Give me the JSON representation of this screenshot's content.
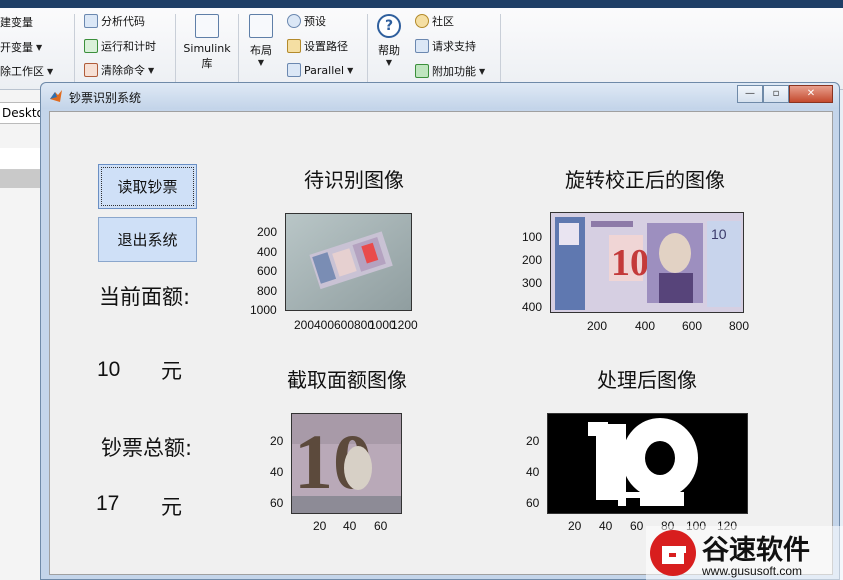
{
  "toolstrip": {
    "items": [
      {
        "label": "建变量",
        "name": "new-variable"
      },
      {
        "label": "开变量",
        "name": "open-variable"
      },
      {
        "label": "除工作区",
        "name": "clear-workspace"
      },
      {
        "label": "分析代码",
        "name": "analyze-code"
      },
      {
        "label": "运行和计时",
        "name": "run-and-time"
      },
      {
        "label": "清除命令",
        "name": "clear-commands"
      },
      {
        "label": "预设",
        "name": "preferences"
      },
      {
        "label": "设置路径",
        "name": "set-path"
      },
      {
        "label": "Parallel",
        "name": "parallel"
      },
      {
        "label": "社区",
        "name": "community"
      },
      {
        "label": "请求支持",
        "name": "request-support"
      },
      {
        "label": "附加功能",
        "name": "add-ons"
      }
    ],
    "simulink_line1": "Simulink",
    "simulink_line2": "库",
    "layout": "布局",
    "help": "帮助"
  },
  "left_pane": {
    "address": "Deskto"
  },
  "figure": {
    "title": "钞票识别系统",
    "buttons": {
      "read": "读取钞票",
      "exit": "退出系统"
    },
    "current_label": "当前面额:",
    "current_value": "10",
    "current_unit": "元",
    "total_label": "钞票总额:",
    "total_value": "17",
    "total_unit": "元",
    "axes": [
      {
        "title": "待识别图像",
        "yticks": [
          "200",
          "400",
          "600",
          "800",
          "1000"
        ],
        "xticks": [
          "200",
          "400",
          "600",
          "800",
          "1000",
          "1200"
        ]
      },
      {
        "title": "旋转校正后的图像",
        "yticks": [
          "100",
          "200",
          "300",
          "400"
        ],
        "xticks": [
          "200",
          "400",
          "600",
          "800"
        ]
      },
      {
        "title": "截取面额图像",
        "yticks": [
          "20",
          "40",
          "60"
        ],
        "xticks": [
          "20",
          "40",
          "60"
        ]
      },
      {
        "title": "处理后图像",
        "yticks": [
          "20",
          "40",
          "60"
        ],
        "xticks": [
          "20",
          "40",
          "60",
          "80",
          "100",
          "120"
        ]
      }
    ]
  },
  "watermark": {
    "brand": "谷速软件",
    "url": "www.gususoft.com"
  },
  "colors": {
    "button": "#cfe0f7",
    "window": "#f0f0f0",
    "watermark_red": "#d81e1e"
  }
}
